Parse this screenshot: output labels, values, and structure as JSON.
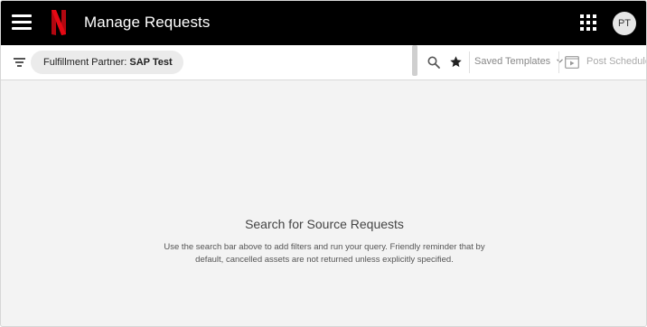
{
  "header": {
    "title": "Manage Requests",
    "avatar_initials": "PT",
    "menu_icon": "hamburger-menu-icon",
    "logo_icon": "netflix-logo",
    "apps_icon": "apps-grid-icon",
    "colors": {
      "background": "#000000",
      "logo": "#e50914"
    }
  },
  "filterbar": {
    "filter_icon": "filter-list-icon",
    "chip": {
      "label": "Fulfillment Partner:",
      "value": "SAP Test"
    },
    "search_icon": "search-icon",
    "star_icon": "star-icon",
    "saved_templates_label": "Saved Templates",
    "post_schedule_label": "Post Schedule"
  },
  "empty_state": {
    "title": "Search for Source Requests",
    "message": "Use the search bar above to add filters and run your query. Friendly reminder that by default, cancelled assets are not returned unless explicitly specified."
  }
}
